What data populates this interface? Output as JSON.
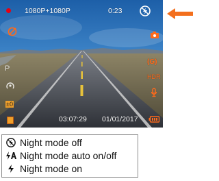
{
  "screen": {
    "status_dot_color": "#e60012",
    "resolution": "1080P+1080P",
    "elapsed": "0:23",
    "night_mode_icon": "night-mode-off-icon",
    "left_icons": [
      "audio-off-icon",
      "parking-p-icon",
      "motion-detection-icon",
      "exposure-icon",
      "battery-left-icon"
    ],
    "right_icons": [
      "camera-icon",
      "g-sensor-icon",
      "hdr-icon",
      "microphone-icon",
      "battery-icon"
    ],
    "g_sensor_label": "(G)",
    "hdr_label": "HDR",
    "exposure_label": "±0",
    "parking_label": "P",
    "time": "03:07:29",
    "date": "01/01/2017",
    "accent_color": "#ff6a1a"
  },
  "legend": {
    "items": [
      {
        "icon": "night-mode-off-icon",
        "label": "Night mode off"
      },
      {
        "icon": "night-mode-auto-icon",
        "label": "Night mode auto on/off"
      },
      {
        "icon": "night-mode-on-icon",
        "label": "Night mode on"
      }
    ]
  }
}
